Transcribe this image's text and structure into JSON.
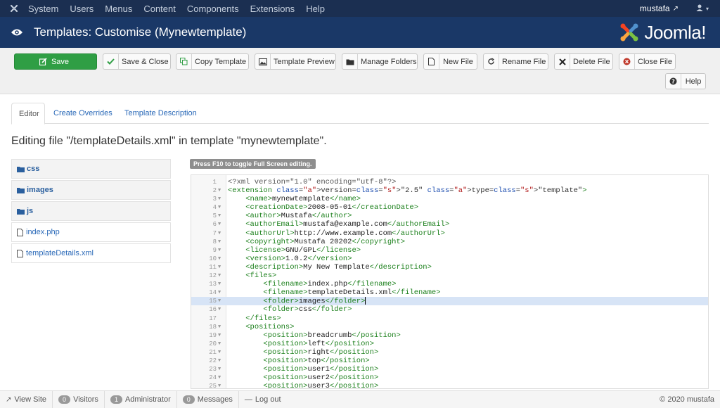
{
  "topnav": {
    "menu": [
      "System",
      "Users",
      "Menus",
      "Content",
      "Components",
      "Extensions",
      "Help"
    ],
    "username": "mustafa"
  },
  "header": {
    "title": "Templates: Customise (Mynewtemplate)",
    "brand": "Joomla!"
  },
  "toolbar": {
    "save": "Save",
    "save_close": "Save & Close",
    "copy_template": "Copy Template",
    "template_preview": "Template Preview",
    "manage_folders": "Manage Folders",
    "new_file": "New File",
    "rename_file": "Rename File",
    "delete_file": "Delete File",
    "close_file": "Close File",
    "help": "Help"
  },
  "tabs": [
    "Editor",
    "Create Overrides",
    "Template Description"
  ],
  "editing_text": "Editing file \"/templateDetails.xml\" in template \"mynewtemplate\".",
  "sidebar": {
    "folders": [
      "css",
      "images",
      "js"
    ],
    "files": [
      "index.php",
      "templateDetails.xml"
    ]
  },
  "editor_hint": "Press F10 to toggle Full Screen editing.",
  "code_lines": [
    "<?xml version=\"1.0\" encoding=\"utf-8\"?>",
    "<extension version=\"2.5\" type=\"template\">",
    "    <name>mynewtemplate</name>",
    "    <creationDate>2008-05-01</creationDate>",
    "    <author>Mustafa</author>",
    "    <authorEmail>mustafa@example.com</authorEmail>",
    "    <authorUrl>http://www.example.com</authorUrl>",
    "    <copyright>Mustafa 20202</copyright>",
    "    <license>GNU/GPL</license>",
    "    <version>1.0.2</version>",
    "    <description>My New Template</description>",
    "    <files>",
    "        <filename>index.php</filename>",
    "        <filename>templateDetails.xml</filename>",
    "        <folder>images</folder>",
    "        <folder>css</folder>",
    "    </files>",
    "    <positions>",
    "        <position>breadcrumb</position>",
    "        <position>left</position>",
    "        <position>right</position>",
    "        <position>top</position>",
    "        <position>user1</position>",
    "        <position>user2</position>",
    "        <position>user3</position>"
  ],
  "highlighted_line": 15,
  "statusbar": {
    "view_site": "View Site",
    "visitors_count": "0",
    "visitors": "Visitors",
    "admin_count": "1",
    "administrator": "Administrator",
    "messages_count": "0",
    "messages": "Messages",
    "logout": "Log out",
    "copyright": "© 2020 mustafa"
  },
  "colors": {
    "topnav": "#1b2f51",
    "header": "#1a3867",
    "save_button": "#2f9e44",
    "link": "#2a69b8",
    "xml_tag": "#1a7f1a",
    "xml_attr_value": "#b11a1a"
  }
}
